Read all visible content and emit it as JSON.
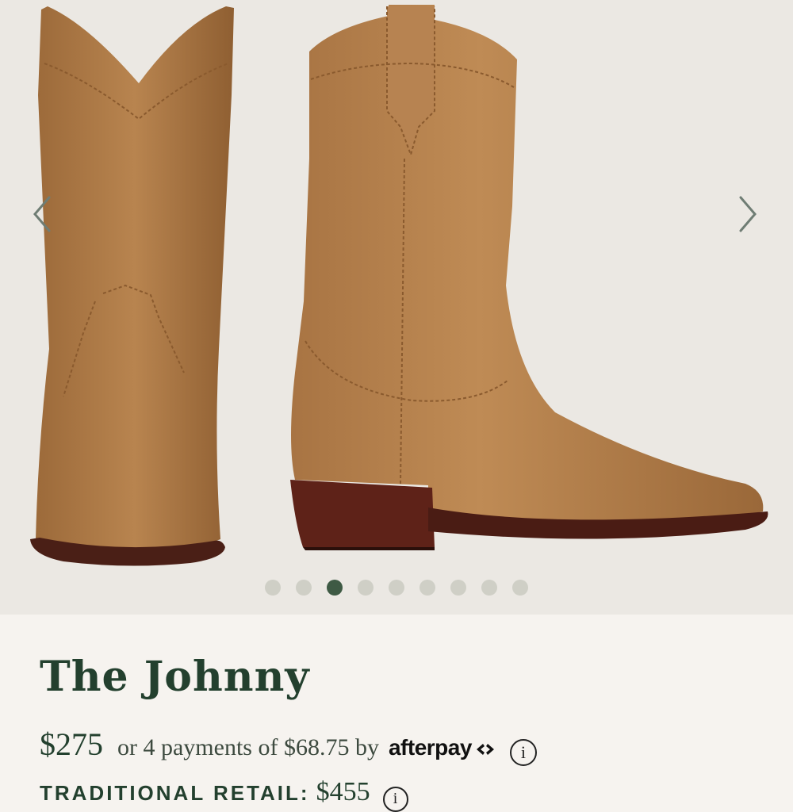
{
  "gallery": {
    "image_alt": "The Johnny boots",
    "prev_icon": "chevron-left-icon",
    "next_icon": "chevron-right-icon",
    "dot_count": 9,
    "active_dot_index": 2
  },
  "product": {
    "title": "The Johnny",
    "price": "$275",
    "installment_text": "or 4 payments of $68.75 by",
    "afterpay_brand": "afterpay",
    "info_glyph": "i",
    "retail_label": "TRADITIONAL RETAIL:",
    "retail_price": "$455"
  },
  "colors": {
    "accent": "#23402e",
    "active_dot": "#3e5a44",
    "inactive_dot": "#cfcfc6",
    "gallery_bg": "#ebe8e3",
    "page_bg": "#f6f3ef",
    "suede": "#b07a45"
  }
}
